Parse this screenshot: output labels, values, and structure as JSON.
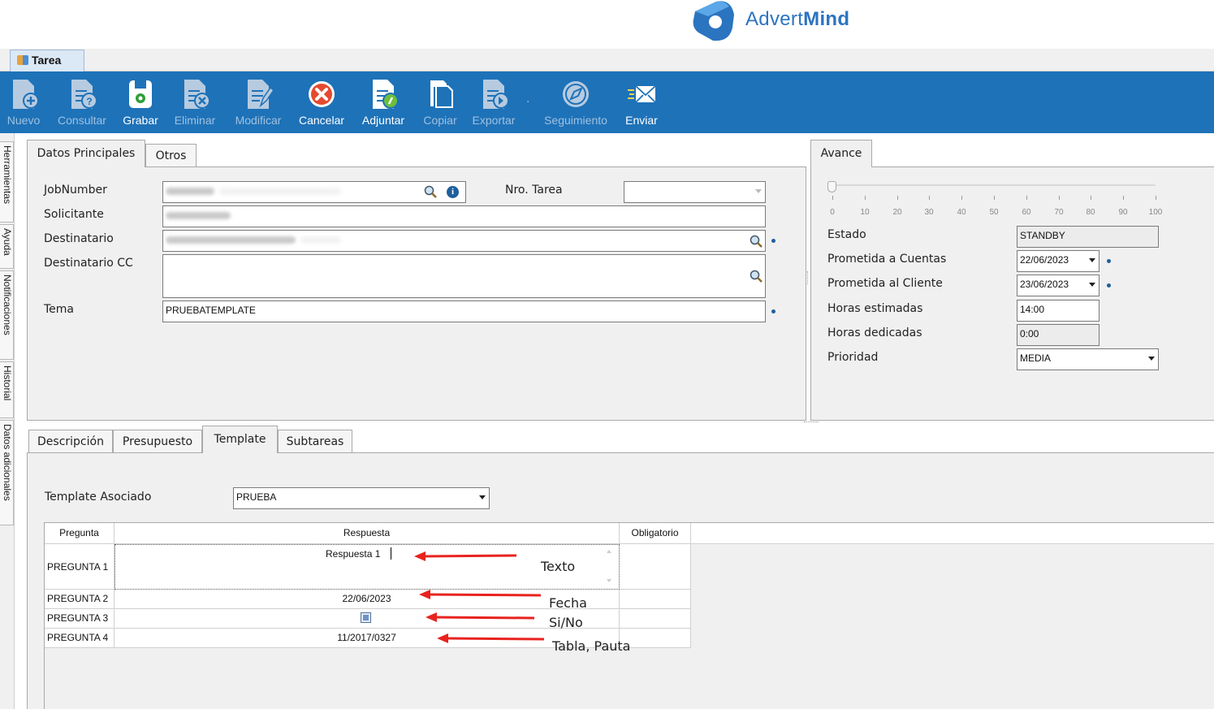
{
  "brand": {
    "name_light": "Advert",
    "name_bold": "Mind",
    "color": "#2b74c0"
  },
  "window": {
    "tab_title": "Tarea"
  },
  "toolbar": {
    "bg_color": "#1e72b8",
    "buttons": [
      {
        "label": "Nuevo",
        "icon": "new-document-icon",
        "enabled": false
      },
      {
        "label": "Consultar",
        "icon": "query-document-icon",
        "enabled": false
      },
      {
        "label": "Grabar",
        "icon": "save-icon",
        "enabled": true
      },
      {
        "label": "Eliminar",
        "icon": "delete-document-icon",
        "enabled": false
      },
      {
        "label": "Modificar",
        "icon": "edit-document-icon",
        "enabled": false
      },
      {
        "label": "Cancelar",
        "icon": "cancel-icon",
        "enabled": true
      },
      {
        "label": "Adjuntar",
        "icon": "attach-icon",
        "enabled": true
      },
      {
        "label": "Copiar",
        "icon": "copy-icon",
        "enabled": false
      },
      {
        "label": "Exportar",
        "icon": "export-icon",
        "enabled": false
      },
      {
        "label": "Seguimiento",
        "icon": "tracking-icon",
        "enabled": false
      },
      {
        "label": "Enviar",
        "icon": "send-mail-icon",
        "enabled": true
      }
    ]
  },
  "side_tabs": [
    "Herramientas",
    "Ayuda",
    "Notificaciones",
    "Historial",
    "Datos adicionales"
  ],
  "main_tabs": [
    {
      "label": "Datos Principales",
      "active": true
    },
    {
      "label": "Otros",
      "active": false
    }
  ],
  "form": {
    "jobnumber_label": "JobNumber",
    "nro_tarea_label": "Nro. Tarea",
    "solicitante_label": "Solicitante",
    "destinatario_label": "Destinatario",
    "destinatario_cc_label": "Destinatario CC",
    "tema_label": "Tema",
    "tema_value": "PRUEBATEMPLATE"
  },
  "avance": {
    "tab_label": "Avance",
    "slider_value": 0,
    "scale": [
      "0",
      "10",
      "20",
      "30",
      "40",
      "50",
      "60",
      "70",
      "80",
      "90",
      "100"
    ],
    "estado_label": "Estado",
    "estado_value": "STANDBY",
    "prometida_cuentas_label": "Prometida a Cuentas",
    "prometida_cuentas_value": "22/06/2023",
    "prometida_cliente_label": "Prometida al Cliente",
    "prometida_cliente_value": "23/06/2023",
    "horas_estimadas_label": "Horas estimadas",
    "horas_estimadas_value": "14:00",
    "horas_dedicadas_label": "Horas dedicadas",
    "horas_dedicadas_value": "0:00",
    "prioridad_label": "Prioridad",
    "prioridad_value": "MEDIA"
  },
  "lower_tabs": [
    {
      "label": "Descripción",
      "active": false
    },
    {
      "label": "Presupuesto",
      "active": false
    },
    {
      "label": "Template",
      "active": true
    },
    {
      "label": "Subtareas",
      "active": false
    }
  ],
  "template": {
    "label": "Template Asociado",
    "value": "PRUEBA",
    "columns": [
      "Pregunta",
      "Respuesta",
      "Obligatorio"
    ],
    "rows": [
      {
        "pregunta": "PREGUNTA 1",
        "respuesta": "Respuesta 1",
        "type": "text"
      },
      {
        "pregunta": "PREGUNTA 2",
        "respuesta": "22/06/2023",
        "type": "date"
      },
      {
        "pregunta": "PREGUNTA 3",
        "respuesta": "",
        "type": "checkbox"
      },
      {
        "pregunta": "PREGUNTA 4",
        "respuesta": "11/2017/0327",
        "type": "table"
      }
    ]
  },
  "annotations": {
    "arrow_color": "#e8231f",
    "items": [
      "Texto",
      "Fecha",
      "Si/No",
      "Tabla, Pauta"
    ]
  }
}
